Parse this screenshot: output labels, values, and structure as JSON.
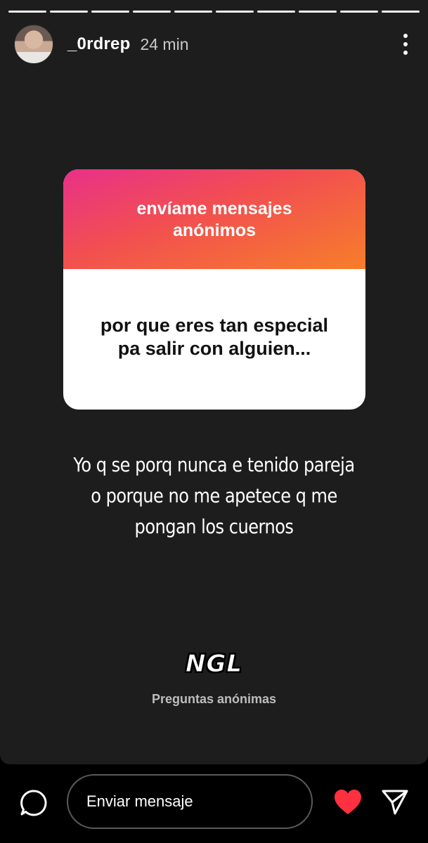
{
  "story": {
    "progress_segments": 10,
    "username": "_0rdrep",
    "time_ago": "24 min"
  },
  "question_card": {
    "header": "envíame mensajes anónimos",
    "question": "por que eres tan especial pa salir con alguien..."
  },
  "reply_text": "Yo q se porq nunca e tenido pareja o porque no me apetece q me pongan los cuernos",
  "ngl": {
    "logo": "NGL",
    "caption": "Preguntas anónimas"
  },
  "message_bar": {
    "placeholder": "Enviar mensaje"
  },
  "icons": {
    "chat": "chat-bubble-icon",
    "like": "heart-icon",
    "send": "send-icon",
    "more": "more-vertical-icon"
  },
  "colors": {
    "background": "#1d1d1d",
    "gradient_start": "#e93089",
    "gradient_end": "#f77e2a",
    "heart": "#ff3040"
  }
}
